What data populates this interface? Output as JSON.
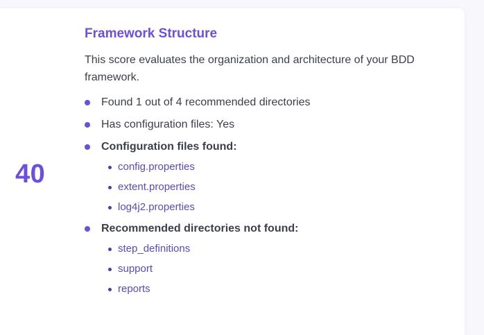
{
  "score": "40",
  "section": {
    "title": "Framework Structure",
    "description": "This score evaluates the organization and architecture of your BDD framework."
  },
  "items": [
    {
      "text": "Found 1 out of 4 recommended directories",
      "bold": false
    },
    {
      "text": "Has configuration files: Yes",
      "bold": false
    },
    {
      "text": "Configuration files found:",
      "bold": true,
      "subitems": [
        "config.properties",
        "extent.properties",
        "log4j2.properties"
      ]
    },
    {
      "text": "Recommended directories not found:",
      "bold": true,
      "subitems": [
        "step_definitions",
        "support",
        "reports"
      ]
    }
  ],
  "colors": {
    "accent": "#6a4fe0",
    "text": "#3c3f4a",
    "sublink": "#5a48c8"
  }
}
